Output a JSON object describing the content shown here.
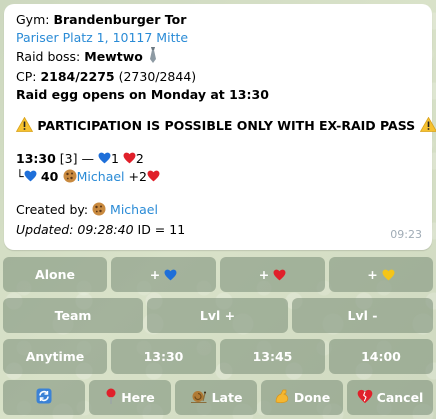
{
  "message": {
    "gym_label": "Gym: ",
    "gym_name": "Brandenburger Tor",
    "address": "Pariser Platz 1, 10117 Mitte",
    "boss_label": "Raid boss: ",
    "boss_name": "Mewtwo",
    "cp_label": "CP: ",
    "cp_value": "2184/2275",
    "cp_extra": " (2730/2844)",
    "egg_text": "Raid egg opens on Monday at 13:30",
    "warning_text": "PARTICIPATION IS POSSIBLE ONLY WITH EX-RAID PASS",
    "slot_time": "13:30",
    "slot_count": " [3] — ",
    "slot_blue": "1",
    "slot_red": "2",
    "attendee_prefix": "└",
    "attendee_level": " 40 ",
    "attendee_name": "Michael",
    "attendee_extra": " +2",
    "created_label": "Created by: ",
    "creator_name": "Michael",
    "updated_label": "Updated: 09:28:40",
    "id_text": "  ID = 11",
    "time": "09:23"
  },
  "keyboard": {
    "alone": "Alone",
    "plus": "+",
    "team": "Team",
    "lvl_up": "Lvl +",
    "lvl_down": "Lvl -",
    "anytime": "Anytime",
    "t1": "13:30",
    "t2": "13:45",
    "t3": "14:00",
    "here": "Here",
    "late": "Late",
    "done": "Done",
    "cancel": "Cancel"
  },
  "icons": {
    "blue_heart": "blue-heart-icon",
    "red_heart": "red-heart-icon",
    "yellow_heart": "yellow-heart-icon",
    "warning": "warning-icon",
    "cookie": "cookie-icon",
    "tie": "necktie-icon",
    "refresh": "refresh-icon",
    "pin": "pushpin-icon",
    "snail": "snail-icon",
    "arm": "flexed-biceps-icon",
    "broken_heart": "broken-heart-icon"
  },
  "colors": {
    "link": "#2a8bd6",
    "heart_blue": "#1e6fd9",
    "heart_red": "#e0202a",
    "heart_yellow": "#f5c518",
    "warning_yellow": "#f6c12f"
  }
}
